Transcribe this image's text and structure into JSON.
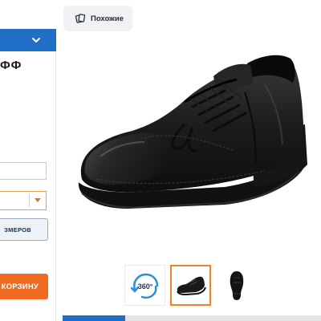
{
  "left_panel": {
    "title_fragment": "ФФ",
    "sizes_button_label": "ЗМЕРОВ",
    "cart_button_label": "КОРЗИНУ",
    "accent_color": "#f06a22",
    "nav_color": "#1f6fc6"
  },
  "similar": {
    "label": "Похожие",
    "icon": "similar-cards-icon"
  },
  "product_image": {
    "subject": "black leather lace-up shoe",
    "icon": "product-photo"
  },
  "thumbnails": [
    {
      "label": "360°",
      "icon": "rotate-360-icon",
      "active": false
    },
    {
      "label": "",
      "icon": "shoe-side-thumb",
      "active": true
    },
    {
      "label": "",
      "icon": "shoe-sole-thumb",
      "active": false
    }
  ]
}
